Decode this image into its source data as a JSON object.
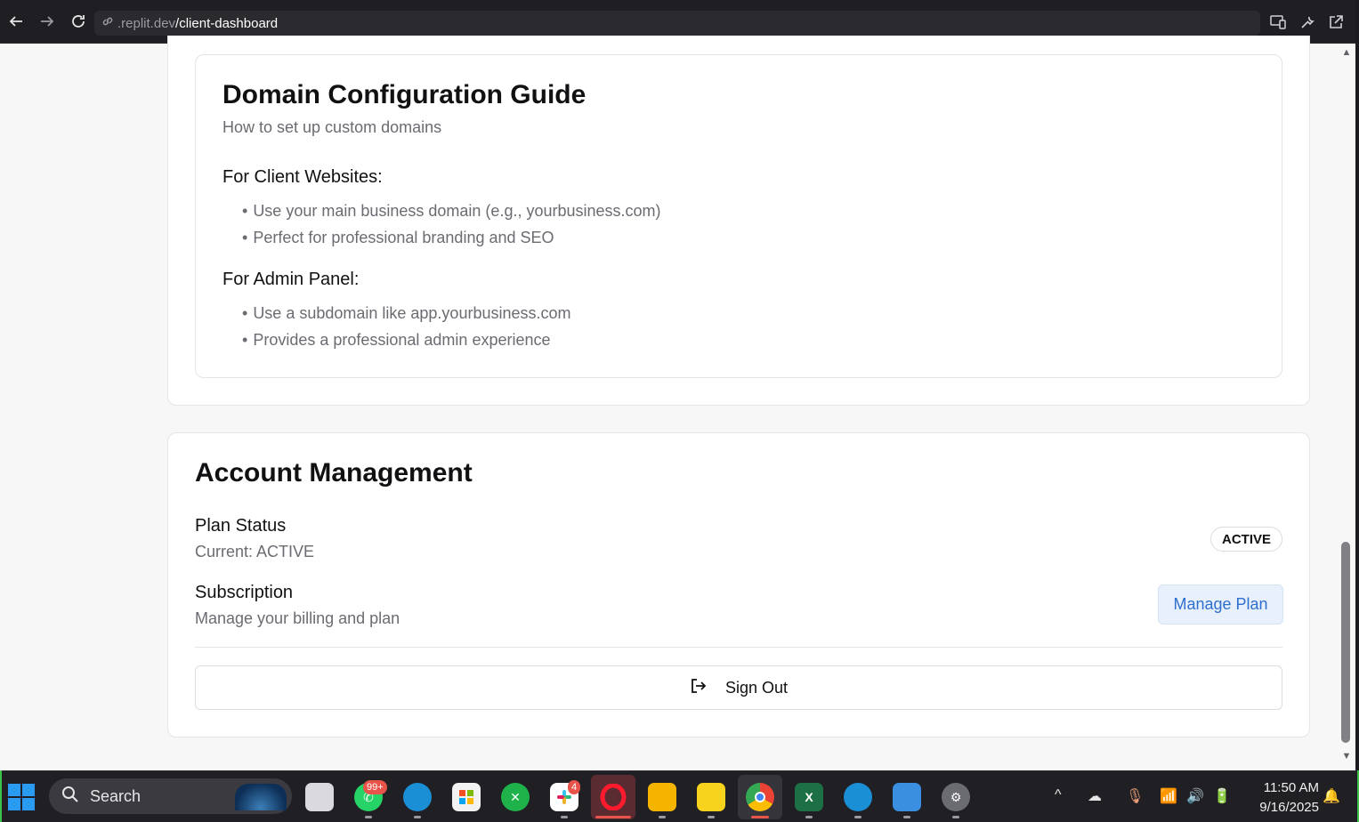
{
  "browser": {
    "url_prefix": ".replit.dev",
    "url_path": "/client-dashboard"
  },
  "guide": {
    "title": "Domain Configuration Guide",
    "subtitle": "How to set up custom domains",
    "sections": [
      {
        "heading": "For Client Websites:",
        "bullets": [
          "Use your main business domain (e.g., yourbusiness.com)",
          "Perfect for professional branding and SEO"
        ]
      },
      {
        "heading": "For Admin Panel:",
        "bullets": [
          "Use a subdomain like app.yourbusiness.com",
          "Provides a professional admin experience"
        ]
      }
    ]
  },
  "account": {
    "title": "Account Management",
    "plan_status_label": "Plan Status",
    "plan_status_current": "Current: ACTIVE",
    "plan_badge": "ACTIVE",
    "subscription_label": "Subscription",
    "subscription_sub": "Manage your billing and plan",
    "manage_button": "Manage Plan",
    "sign_out": "Sign Out"
  },
  "taskbar": {
    "search_label": "Search",
    "whatsapp_badge": "99+",
    "slack_badge": "4",
    "time": "11:50 AM",
    "date": "9/16/2025",
    "apps": [
      "task-view",
      "whatsapp",
      "edge-profile",
      "microsoft-store",
      "app-green",
      "slack",
      "opera",
      "file-explorer",
      "sticky-notes",
      "chrome",
      "excel",
      "edge",
      "photos",
      "settings"
    ]
  },
  "colors": {
    "accent_blue": "#2f6fce",
    "badge_red": "#e8534a"
  }
}
